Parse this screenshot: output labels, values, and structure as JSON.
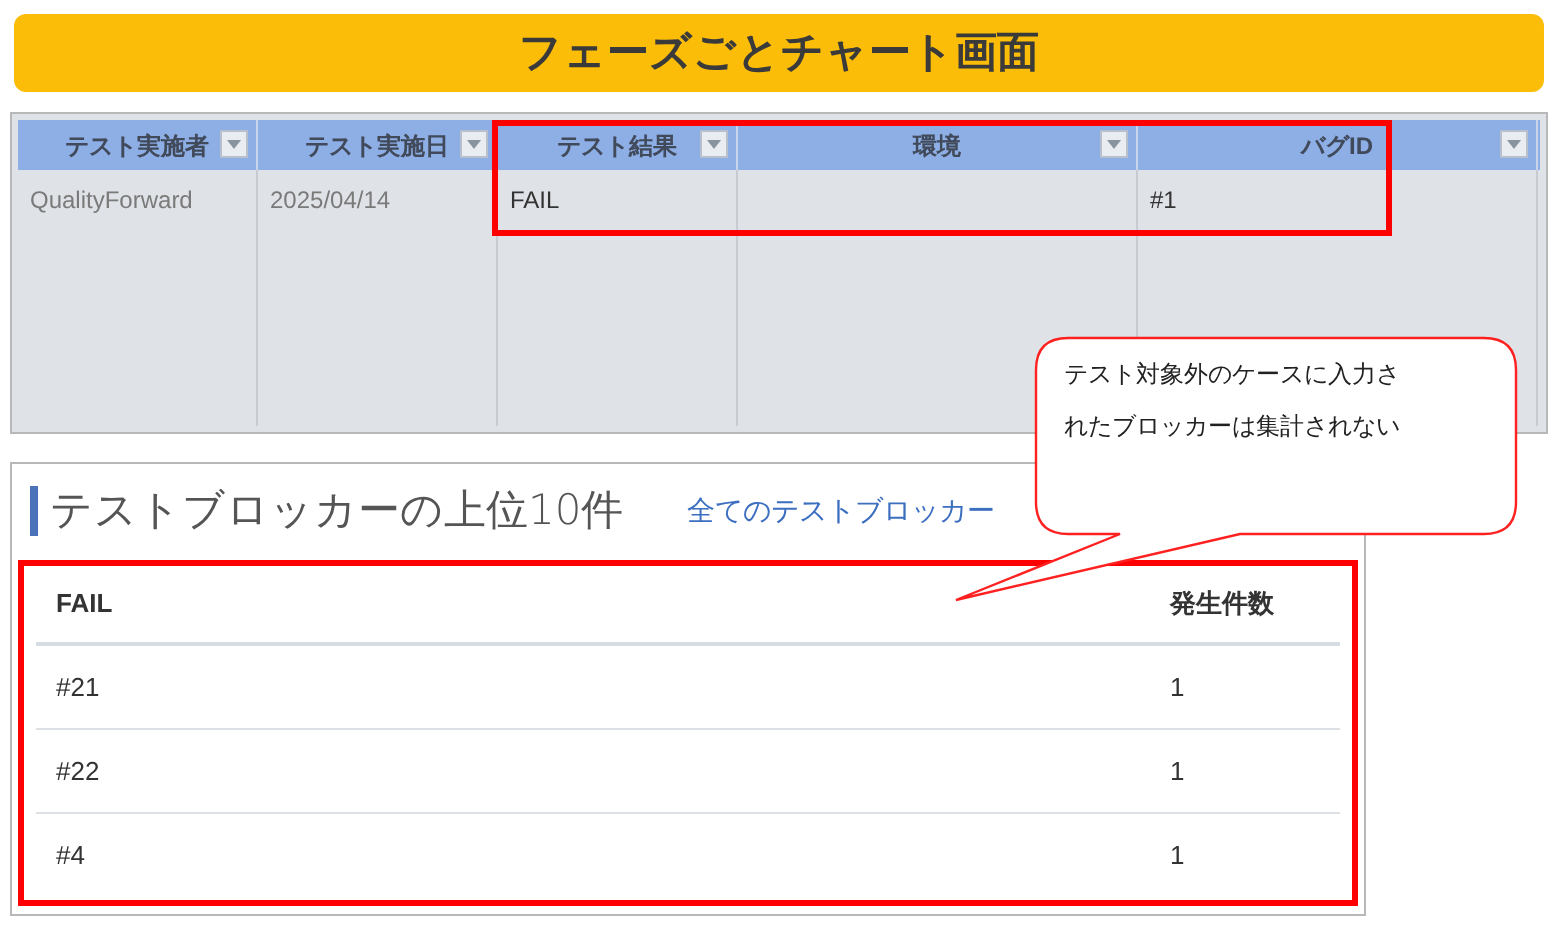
{
  "title": "フェーズごとチャート画面",
  "grid": {
    "columns": [
      {
        "label": "テスト実施者",
        "filter": true
      },
      {
        "label": "テスト実施日",
        "filter": true
      },
      {
        "label": "テスト結果",
        "filter": true
      },
      {
        "label": "環境",
        "filter": true
      },
      {
        "label": "バグID",
        "filter": true
      }
    ],
    "rows": [
      [
        "QualityForward",
        "2025/04/14",
        "FAIL",
        "",
        "#1"
      ]
    ]
  },
  "blockers": {
    "heading": "テストブロッカーの上位10件",
    "link": "全てのテストブロッカー",
    "columns": [
      "FAIL",
      "発生件数"
    ],
    "rows": [
      [
        "#21",
        "1"
      ],
      [
        "#22",
        "1"
      ],
      [
        "#4",
        "1"
      ]
    ]
  },
  "callout": {
    "lines": [
      "テスト対象外のケースに入力さ",
      "れたブロッカーは集計されない"
    ]
  }
}
